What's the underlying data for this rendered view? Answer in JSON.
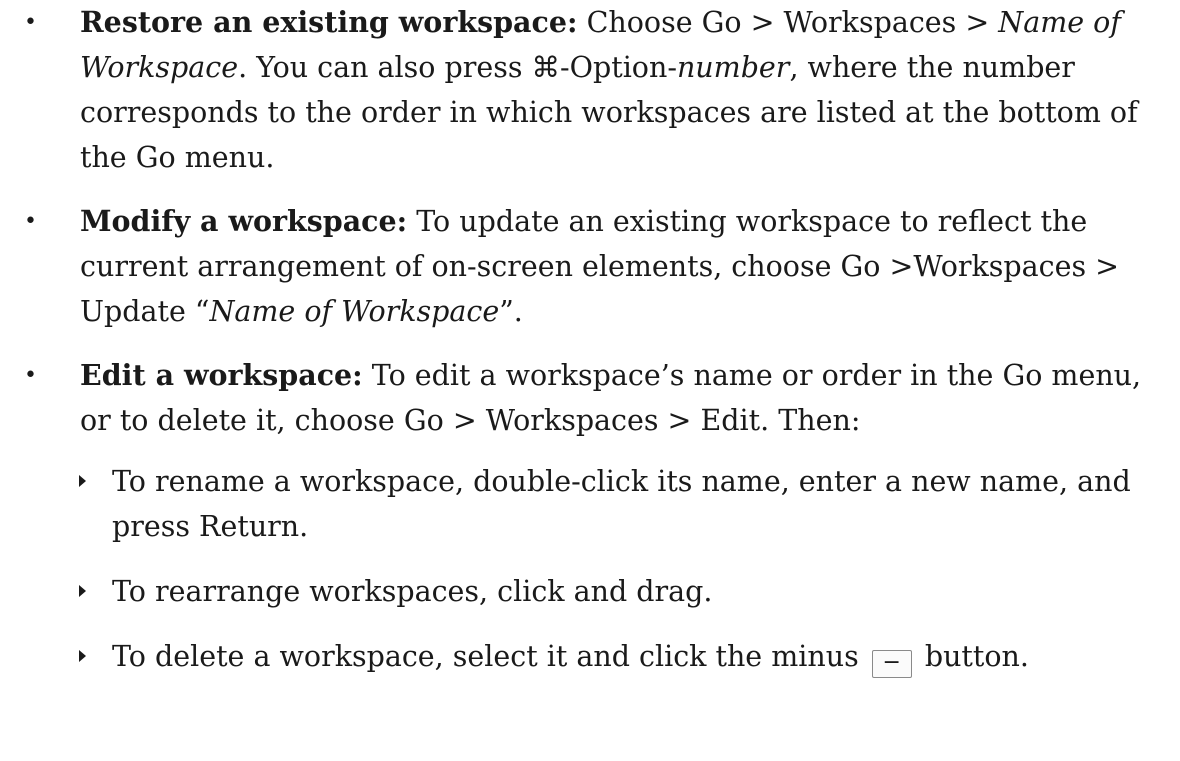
{
  "items": [
    {
      "bold": "Restore an existing workspace:",
      "t1": " Choose Go > Workspaces > ",
      "i1": "Name of Workspace",
      "t2": ". You can also press ⌘-Option-",
      "i2": "number",
      "t3": ", where the number corresponds to the order in which workspaces are listed at the bottom of the Go menu."
    },
    {
      "bold": "Modify a workspace:",
      "t1": " To update an existing workspace to reflect the current arrangement of on-screen elements, choose Go >Work­spaces > Update “",
      "i1": "Name of Workspace",
      "t2": "”."
    },
    {
      "bold": "Edit a workspace:",
      "t1": " To edit a workspace’s name or order in the Go menu, or to delete it, choose Go > Workspaces > Edit. Then:"
    }
  ],
  "subitems": [
    "To rename a workspace, double-click its name, enter a new name, and press Return.",
    "To rearrange workspaces, click and drag.",
    {
      "before": "To delete a workspace, select it and click the minus ",
      "button": "−",
      "after": " button."
    }
  ],
  "icons": {
    "bullet": "bullet-dot",
    "subbullet": "triangle-right",
    "button": "minus-button"
  }
}
